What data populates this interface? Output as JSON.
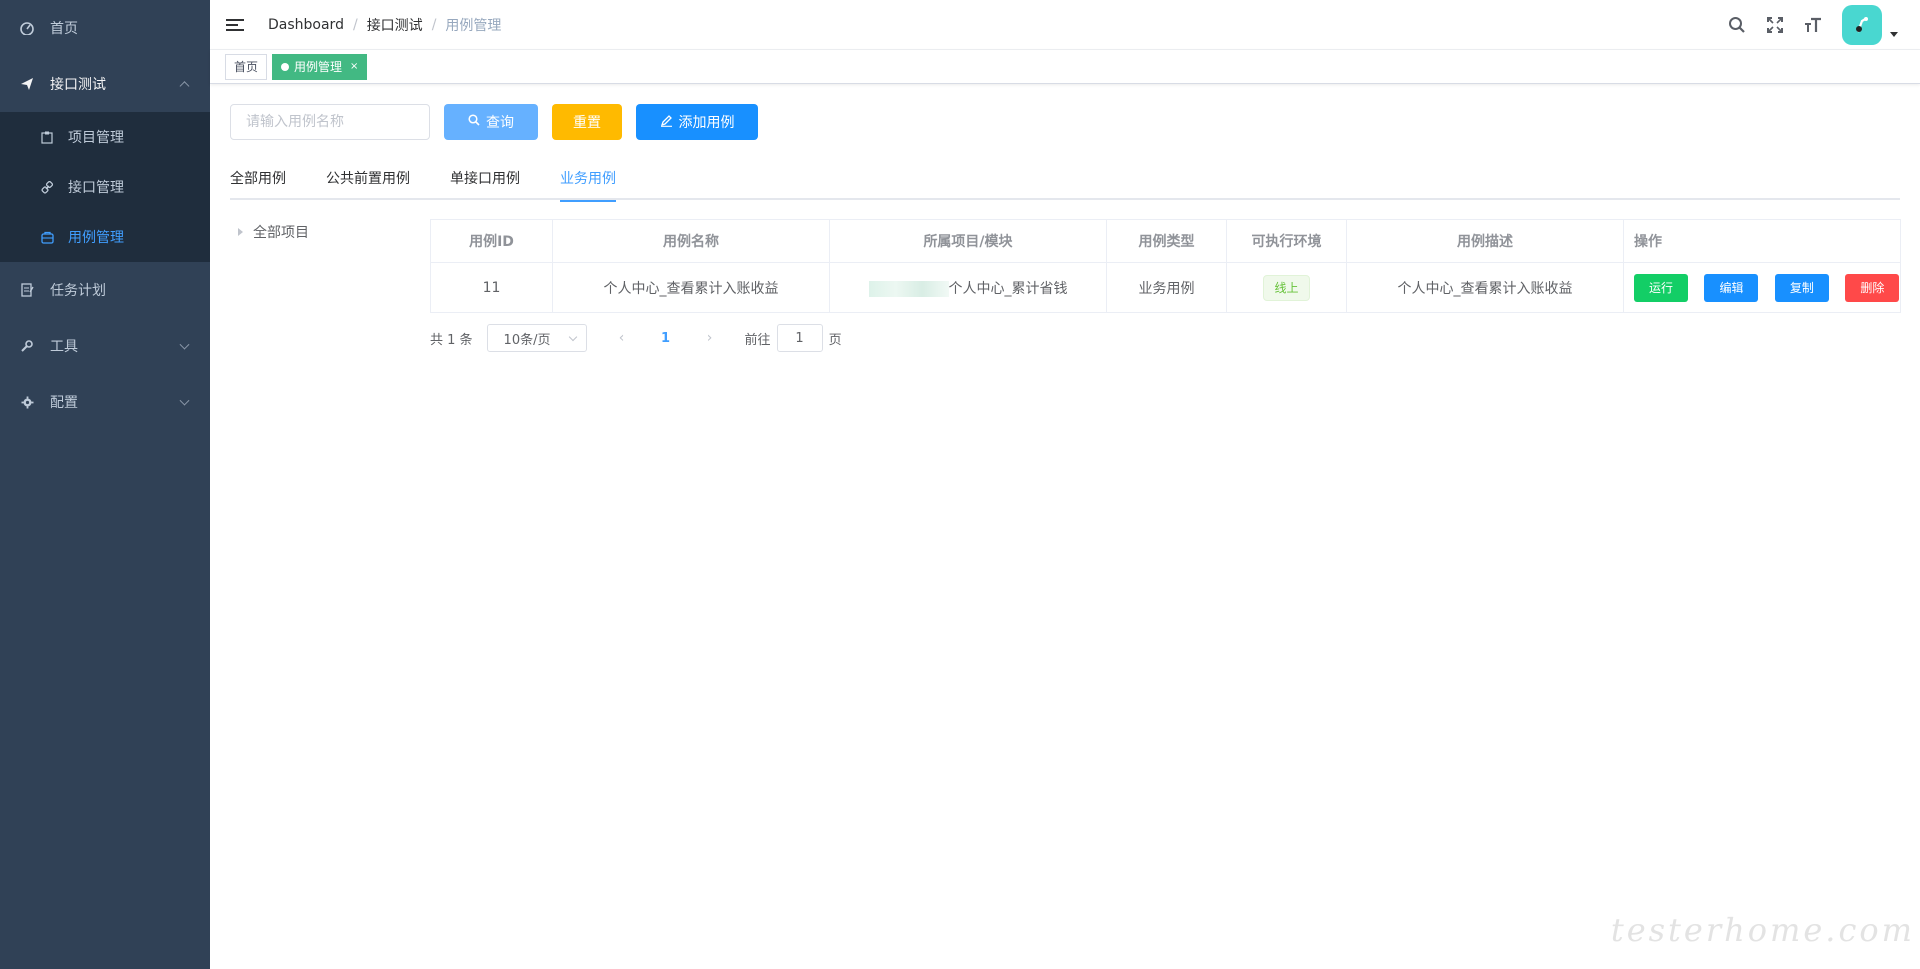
{
  "sidebar": {
    "items": [
      {
        "label": "首页",
        "icon": "dashboard-icon"
      },
      {
        "label": "接口测试",
        "icon": "send-icon",
        "open": true,
        "children": [
          {
            "label": "项目管理",
            "icon": "clipboard-icon"
          },
          {
            "label": "接口管理",
            "icon": "link-icon"
          },
          {
            "label": "用例管理",
            "icon": "case-icon",
            "active": true
          }
        ]
      },
      {
        "label": "任务计划",
        "icon": "edit-doc-icon"
      },
      {
        "label": "工具",
        "icon": "wrench-icon"
      },
      {
        "label": "配置",
        "icon": "gear-icon"
      }
    ]
  },
  "navbar": {
    "breadcrumb": [
      "Dashboard",
      "接口测试",
      "用例管理"
    ]
  },
  "tags": [
    {
      "label": "首页"
    },
    {
      "label": "用例管理",
      "active": true,
      "close": "×"
    }
  ],
  "search": {
    "placeholder": "请输入用例名称",
    "query_label": "查询",
    "reset_label": "重置",
    "add_label": "添加用例"
  },
  "tabs": [
    "全部用例",
    "公共前置用例",
    "单接口用例",
    "业务用例"
  ],
  "active_tab": "业务用例",
  "tree": {
    "root_label": "全部项目"
  },
  "table": {
    "headers": [
      "用例ID",
      "用例名称",
      "所属项目/模块",
      "用例类型",
      "可执行环境",
      "用例描述",
      "操作"
    ],
    "rows": [
      {
        "id": "11",
        "name": "个人中心_查看累计入账收益",
        "module": "个人中心_累计省钱",
        "type": "业务用例",
        "env": "线上",
        "desc": "个人中心_查看累计入账收益",
        "actions": {
          "run": "运行",
          "edit": "编辑",
          "copy": "复制",
          "delete": "删除"
        }
      }
    ]
  },
  "pagination": {
    "total": "共 1 条",
    "page_size": "10条/页",
    "current_page": "1",
    "goto_prefix": "前往",
    "goto_value": "1",
    "goto_suffix": "页"
  },
  "watermark": "testerhome.com",
  "colors": {
    "sidebar_bg": "#304156",
    "submenu_bg": "#1f2d3d",
    "active_blue": "#409eff",
    "tag_green": "#42b983",
    "run_green": "#13ce66",
    "delete_red": "#ff4949",
    "reset_yellow": "#ffba00"
  }
}
